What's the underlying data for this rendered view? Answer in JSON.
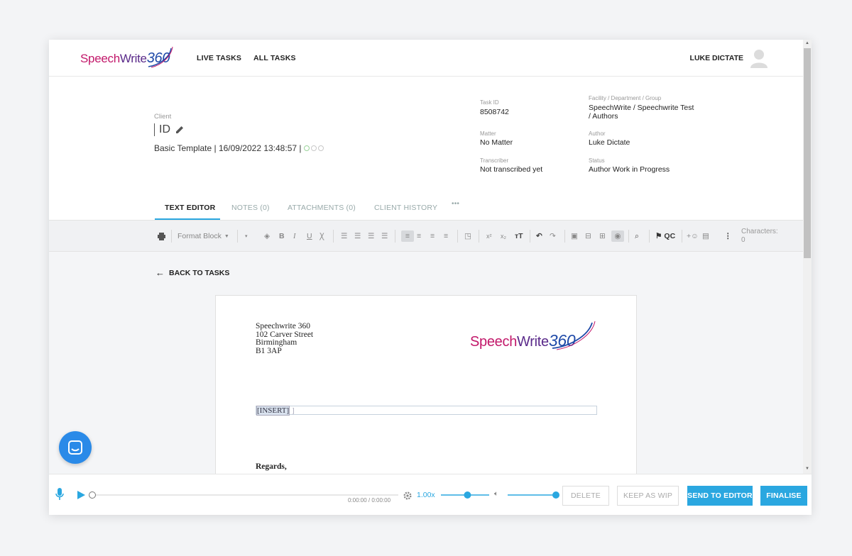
{
  "header": {
    "logo": {
      "speech": "Speech",
      "write": "Write",
      "num": "360"
    },
    "nav": {
      "live_tasks": "LIVE TASKS",
      "all_tasks": "ALL TASKS"
    },
    "user_name": "LUKE DICTATE"
  },
  "task": {
    "client_label": "Client",
    "id_label": "ID",
    "template_line": "Basic Template | 16/09/2022 13:48:57 |",
    "task_id_label": "Task ID",
    "task_id": "8508742",
    "matter_label": "Matter",
    "matter": "No Matter",
    "transcriber_label": "Transcriber",
    "transcriber": "Not transcribed yet",
    "facility_label": "Facility / Department / Group",
    "facility_line1": "SpeechWrite / Speechwrite Test",
    "facility_line2": "/ Authors",
    "author_label": "Author",
    "author": "Luke Dictate",
    "status_label": "Status",
    "status": "Author Work in Progress"
  },
  "tabs": {
    "text_editor": "TEXT EDITOR",
    "notes": "NOTES (0)",
    "attachments": "ATTACHMENTS (0)",
    "client_history": "CLIENT HISTORY",
    "more": "•••"
  },
  "toolbar": {
    "format_block": "Format Block",
    "qc": "QC",
    "characters_label": "Characters:",
    "characters_count": "0"
  },
  "content": {
    "back_link": "BACK TO TASKS",
    "address": [
      "Speechwrite 360",
      "102 Carver Street",
      "Birmingham",
      "B1 3AP"
    ],
    "insert_field": "[INSERT]",
    "regards": "Regards,"
  },
  "player": {
    "time": "0:00:00 / 0:00:00",
    "speed": "1.00x",
    "progress": 0,
    "speed_slider": 0.55,
    "volume": 1.0,
    "delete": "DELETE",
    "keep_as_wip": "KEEP AS WIP",
    "send_to_editor": "SEND TO EDITOR",
    "finalise": "FINALISE"
  },
  "colors": {
    "accent": "#2aa7e0",
    "brand_pink": "#c2186a",
    "brand_blue": "#1f4aa8",
    "chat_bubble": "#2a8ae8"
  }
}
